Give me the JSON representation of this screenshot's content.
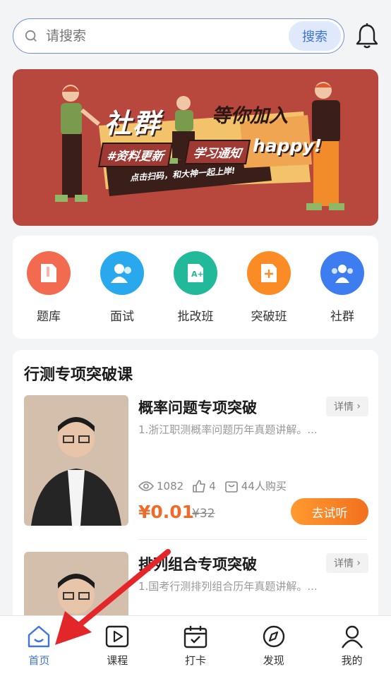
{
  "search": {
    "placeholder": "请搜索",
    "button_label": "搜索"
  },
  "banner": {
    "headline_a": "社群",
    "headline_b": "等你加入",
    "tag_1": "#资料更新",
    "tag_2": "学习通知",
    "tag_3": "happy!",
    "subline": "点击扫码，和大神一起上岸!"
  },
  "menu": {
    "items": [
      {
        "label": "题库",
        "icon": "question-bank-icon",
        "color": "#f26a4f"
      },
      {
        "label": "面试",
        "icon": "interview-icon",
        "color": "#2aa8ee"
      },
      {
        "label": "批改班",
        "icon": "grading-class-icon",
        "color": "#22b89a"
      },
      {
        "label": "突破班",
        "icon": "breakthrough-class-icon",
        "color": "#fb8b25"
      },
      {
        "label": "社群",
        "icon": "community-icon",
        "color": "#3d7df0"
      }
    ]
  },
  "courses_section": {
    "title": "行测专项突破课",
    "courses": [
      {
        "name": "概率问题专项突破",
        "detail_label": "详情",
        "desc": "1.浙江职测概率问题历年真题讲解。...",
        "views": "1082",
        "likes": "4",
        "buyers": "44人购买",
        "price": "¥0.01",
        "old_price": "¥32",
        "try_label": "去试听"
      },
      {
        "name": "排列组合专项突破",
        "detail_label": "详情",
        "desc": "1.国考行测排列组合历年真题讲解。..."
      }
    ]
  },
  "tabbar": {
    "items": [
      {
        "label": "首页",
        "icon": "home-icon",
        "active": true
      },
      {
        "label": "课程",
        "icon": "play-icon"
      },
      {
        "label": "打卡",
        "icon": "calendar-check-icon"
      },
      {
        "label": "发现",
        "icon": "compass-icon"
      },
      {
        "label": "我的",
        "icon": "profile-icon"
      }
    ]
  },
  "colors": {
    "accent": "#3f74db",
    "price": "#f06a2a",
    "banner_bg": "#b8473d"
  }
}
